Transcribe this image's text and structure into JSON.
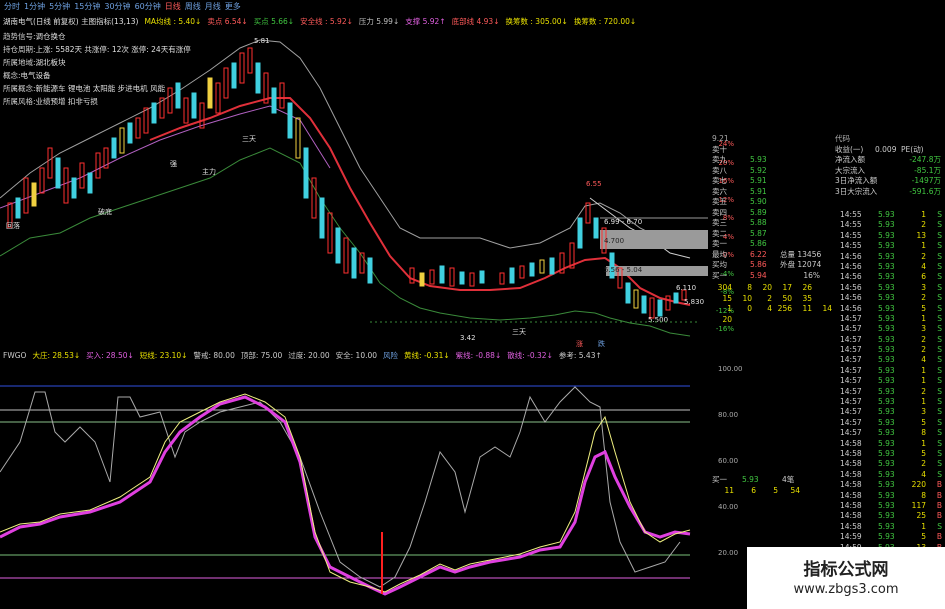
{
  "tabs": [
    "分时",
    "1分钟",
    "5分钟",
    "15分钟",
    "30分钟",
    "60分钟",
    "日线",
    "周线",
    "月线",
    "更多"
  ],
  "infobar": {
    "stock": "湖南电气(日线 前复权) 主图指标(13,13)",
    "ma": "MA均线 : 5.40↓",
    "sell": "卖点 6.54↓",
    "buy": "买点 5.66↓",
    "safe": "安全线 : 5.92↓",
    "pressure": "压力 5.99↓",
    "support": "支撑 5.92↑",
    "bottom": "底部线 4.93↓",
    "chip": "换筹数 : 305.00↓",
    "chip2": "换筹数 : 720.00↓"
  },
  "annotations": [
    {
      "k": "趋势信号:",
      "v": "调仓换仓"
    },
    {
      "k": "持仓周期:",
      "v": "上涨: 5582天  共涨停: 12次  涨停: 24天有涨停"
    },
    {
      "k": "所属地域:",
      "v": "湖北板块"
    },
    {
      "k": "概念:",
      "v": "电气设备"
    },
    {
      "k": "所属概念:",
      "v": "新能源车 锂电池 太阳能 步进电机 风能"
    },
    {
      "k": "所属风格:",
      "v": "业绩预增 扣非亏损"
    }
  ],
  "candle_labels": {
    "l1": "5.81",
    "l2": "强",
    "l3": "三天",
    "l4": "3.42",
    "l5": "6.55",
    "l6": "6.99 - 6.70",
    "l7": "4.700",
    "l8": "5.56 - 5.04",
    "l9": "6.110",
    "l10": "5.830",
    "l11": "5.500",
    "l12": "涨",
    "l13": "跌",
    "l14": "三天",
    "l15": "破底",
    "l16": "主力",
    "l17": "回落"
  },
  "pct_labels": [
    "24%",
    "20%",
    "16%",
    "12%",
    "8%",
    "4%",
    "0%",
    "-4%",
    "-8%",
    "-12%",
    "-16%"
  ],
  "right_panel": {
    "header": [
      "9.21",
      "代码",
      "收益(一)",
      "0.009",
      "PE(动)"
    ],
    "quote_rows": [
      {
        "a": "卖十",
        "b": "",
        "c": ""
      },
      {
        "a": "卖九",
        "b": "5.93",
        "c": ""
      },
      {
        "a": "卖八",
        "b": "5.92",
        "c": ""
      },
      {
        "a": "卖七",
        "b": "5.91",
        "c": ""
      },
      {
        "a": "卖六",
        "b": "5.91",
        "c": ""
      },
      {
        "a": "卖五",
        "b": "5.90",
        "c": ""
      },
      {
        "a": "卖四",
        "b": "5.89",
        "c": ""
      },
      {
        "a": "卖三",
        "b": "5.88",
        "c": ""
      },
      {
        "a": "卖二",
        "b": "5.87",
        "c": ""
      },
      {
        "a": "卖一",
        "b": "5.86",
        "c": ""
      },
      {
        "a": "最均",
        "b": "6.22",
        "c": "总量 13456"
      },
      {
        "a": "买均",
        "b": "5.86",
        "c": "外盘 12074"
      },
      {
        "a": "买一",
        "b": "5.94",
        "c": "16%"
      }
    ],
    "flows": [
      {
        "label": "净流入额",
        "value": "-247.8万"
      },
      {
        "label": "大宗流入",
        "value": "-85.1万"
      },
      {
        "label": "3日净流入额",
        "value": "-1497万"
      },
      {
        "label": "3日大宗流入",
        "value": "-591.6万"
      }
    ],
    "volume_row1": [
      "304",
      "8",
      "20",
      "17",
      "26"
    ],
    "volume_row2": [
      "15",
      "10",
      "2",
      "50",
      "35"
    ],
    "volume_row3": [
      "1",
      "0",
      "4",
      "256",
      "11",
      "14"
    ],
    "volume_row4": [
      "20"
    ],
    "buy_line": {
      "label": "买一",
      "price": "5.93",
      "vol": "4笔"
    },
    "buy_sub": [
      "11",
      "6",
      "5",
      "54"
    ]
  },
  "ticks": [
    {
      "t": "14:55",
      "p": "5.93",
      "v": "1",
      "s": "S"
    },
    {
      "t": "14:55",
      "p": "5.93",
      "v": "2",
      "s": "S"
    },
    {
      "t": "14:55",
      "p": "5.93",
      "v": "13",
      "s": "S"
    },
    {
      "t": "14:55",
      "p": "5.93",
      "v": "1",
      "s": "S"
    },
    {
      "t": "14:56",
      "p": "5.93",
      "v": "2",
      "s": "S"
    },
    {
      "t": "14:56",
      "p": "5.93",
      "v": "4",
      "s": "S"
    },
    {
      "t": "14:56",
      "p": "5.93",
      "v": "6",
      "s": "S"
    },
    {
      "t": "14:56",
      "p": "5.93",
      "v": "3",
      "s": "S"
    },
    {
      "t": "14:56",
      "p": "5.93",
      "v": "2",
      "s": "S"
    },
    {
      "t": "14:56",
      "p": "5.93",
      "v": "5",
      "s": "S"
    },
    {
      "t": "14:57",
      "p": "5.93",
      "v": "1",
      "s": "S"
    },
    {
      "t": "14:57",
      "p": "5.93",
      "v": "3",
      "s": "S"
    },
    {
      "t": "14:57",
      "p": "5.93",
      "v": "2",
      "s": "S"
    },
    {
      "t": "14:57",
      "p": "5.93",
      "v": "2",
      "s": "S"
    },
    {
      "t": "14:57",
      "p": "5.93",
      "v": "4",
      "s": "S"
    },
    {
      "t": "14:57",
      "p": "5.93",
      "v": "1",
      "s": "S"
    },
    {
      "t": "14:57",
      "p": "5.93",
      "v": "1",
      "s": "S"
    },
    {
      "t": "14:57",
      "p": "5.93",
      "v": "2",
      "s": "S"
    },
    {
      "t": "14:57",
      "p": "5.93",
      "v": "1",
      "s": "S"
    },
    {
      "t": "14:57",
      "p": "5.93",
      "v": "3",
      "s": "S"
    },
    {
      "t": "14:57",
      "p": "5.93",
      "v": "5",
      "s": "S"
    },
    {
      "t": "14:57",
      "p": "5.93",
      "v": "8",
      "s": "S"
    },
    {
      "t": "14:58",
      "p": "5.93",
      "v": "1",
      "s": "S"
    },
    {
      "t": "14:58",
      "p": "5.93",
      "v": "5",
      "s": "S"
    },
    {
      "t": "14:58",
      "p": "5.93",
      "v": "2",
      "s": "S"
    },
    {
      "t": "14:58",
      "p": "5.93",
      "v": "4",
      "s": "S"
    },
    {
      "t": "14:58",
      "p": "5.93",
      "v": "220",
      "s": "B"
    },
    {
      "t": "14:58",
      "p": "5.93",
      "v": "8",
      "s": "B"
    },
    {
      "t": "14:58",
      "p": "5.93",
      "v": "117",
      "s": "B"
    },
    {
      "t": "14:58",
      "p": "5.93",
      "v": "25",
      "s": "B"
    },
    {
      "t": "14:58",
      "p": "5.93",
      "v": "1",
      "s": "S"
    },
    {
      "t": "14:59",
      "p": "5.93",
      "v": "5",
      "s": "B"
    },
    {
      "t": "14:59",
      "p": "5.93",
      "v": "13",
      "s": "B"
    },
    {
      "t": "14:59",
      "p": "5.93",
      "v": "1",
      "s": "S"
    },
    {
      "t": "14:59",
      "p": "5.93",
      "v": "13",
      "s": "S"
    },
    {
      "t": "14:59",
      "p": "5.93",
      "v": "37",
      "s": "S"
    }
  ],
  "osc_bar": [
    "FWGO",
    "大庄: 28.53↓",
    "买入: 28.50↓",
    "短线: 23.10↓",
    "警戒: 80.00",
    "顶部: 75.00",
    "过度: 20.00",
    "安全: 10.00",
    "风险",
    "黄线: -0.31↓",
    "紫线: -0.88↓",
    "散线: -0.32↓",
    "参考: 5.43↑"
  ],
  "osc_scale": [
    "100.00",
    "80.00",
    "60.00",
    "40.00",
    "20.00"
  ],
  "watermark": {
    "line1": "指标公式网",
    "line2": "www.zbgs3.com"
  }
}
